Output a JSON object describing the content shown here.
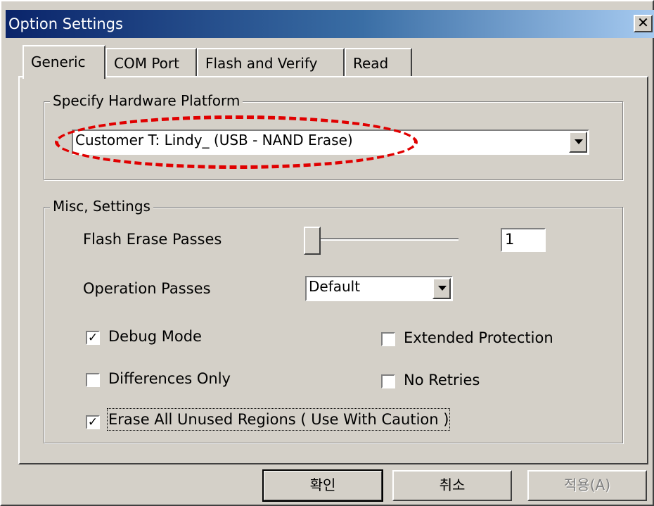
{
  "window": {
    "title": "Option Settings",
    "close_glyph": "✕"
  },
  "tabs": [
    {
      "label": "Generic",
      "active": true
    },
    {
      "label": "COM Port",
      "active": false
    },
    {
      "label": "Flash and Verify",
      "active": false
    },
    {
      "label": "Read",
      "active": false
    }
  ],
  "hardware_group": {
    "legend": "Specify Hardware Platform",
    "platform_value": "Customer T: Lindy_ (USB - NAND Erase)"
  },
  "misc_group": {
    "legend": "Misc, Settings",
    "flash_erase_passes_label": "Flash Erase Passes",
    "flash_erase_passes_value": "1",
    "slider_position": 0,
    "operation_passes_label": "Operation Passes",
    "operation_passes_value": "Default",
    "checkboxes": {
      "debug_mode": {
        "label": "Debug Mode",
        "checked": true
      },
      "extended_protection": {
        "label": "Extended Protection",
        "checked": false
      },
      "differences_only": {
        "label": "Differences Only",
        "checked": false
      },
      "no_retries": {
        "label": "No Retries",
        "checked": false
      },
      "erase_all_unused": {
        "label": "Erase All Unused Regions ( Use With Caution )",
        "checked": true
      }
    }
  },
  "buttons": {
    "ok": "확인",
    "cancel": "취소",
    "apply": "적용(A)"
  },
  "colors": {
    "title_gradient_start": "#0a246a",
    "title_gradient_end": "#a6caf0",
    "face": "#d4d0c8",
    "annotation": "#e00000"
  },
  "icons": {
    "close": "close-icon",
    "dropdown": "chevron-down-icon",
    "check": "checkmark-icon"
  }
}
